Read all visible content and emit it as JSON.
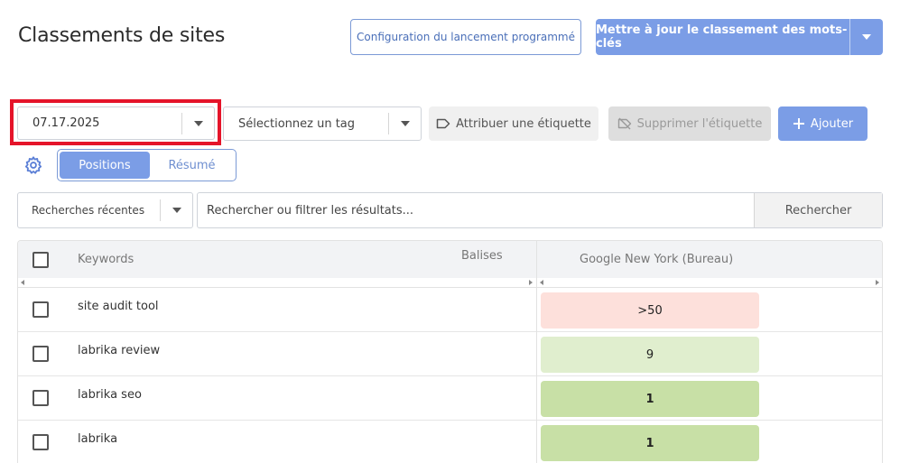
{
  "page": {
    "title": "Classements de sites"
  },
  "header": {
    "config_button": "Configuration du lancement programmé",
    "update_button": "Mettre à jour le classement des mots-clés"
  },
  "toolbar": {
    "date_value": "07.17.2025",
    "tag_placeholder": "Sélectionnez un tag",
    "assign_label": "Attribuer une étiquette",
    "remove_label": "Supprimer l'étiquette",
    "add_label": "Ajouter"
  },
  "view_toggle": {
    "positions": "Positions",
    "summary": "Résumé",
    "active": "Positions"
  },
  "search": {
    "recent_label": "Recherches récentes",
    "placeholder": "Rechercher ou filtrer les résultats...",
    "button": "Rechercher"
  },
  "table": {
    "headers": {
      "keywords": "Keywords",
      "tags": "Balises",
      "engine": "Google New York (Bureau)"
    },
    "rows": [
      {
        "keyword": "site audit tool",
        "position": ">50",
        "color": "#fde0db"
      },
      {
        "keyword": "labrika review",
        "position": "9",
        "color": "#e0eece"
      },
      {
        "keyword": "labrika seo",
        "position": "1",
        "color": "#c8e0a6"
      },
      {
        "keyword": "labrika",
        "position": "1",
        "color": "#c8e0a6"
      }
    ]
  },
  "colors": {
    "accent": "#7b9de6",
    "highlight": "#e5142a"
  }
}
